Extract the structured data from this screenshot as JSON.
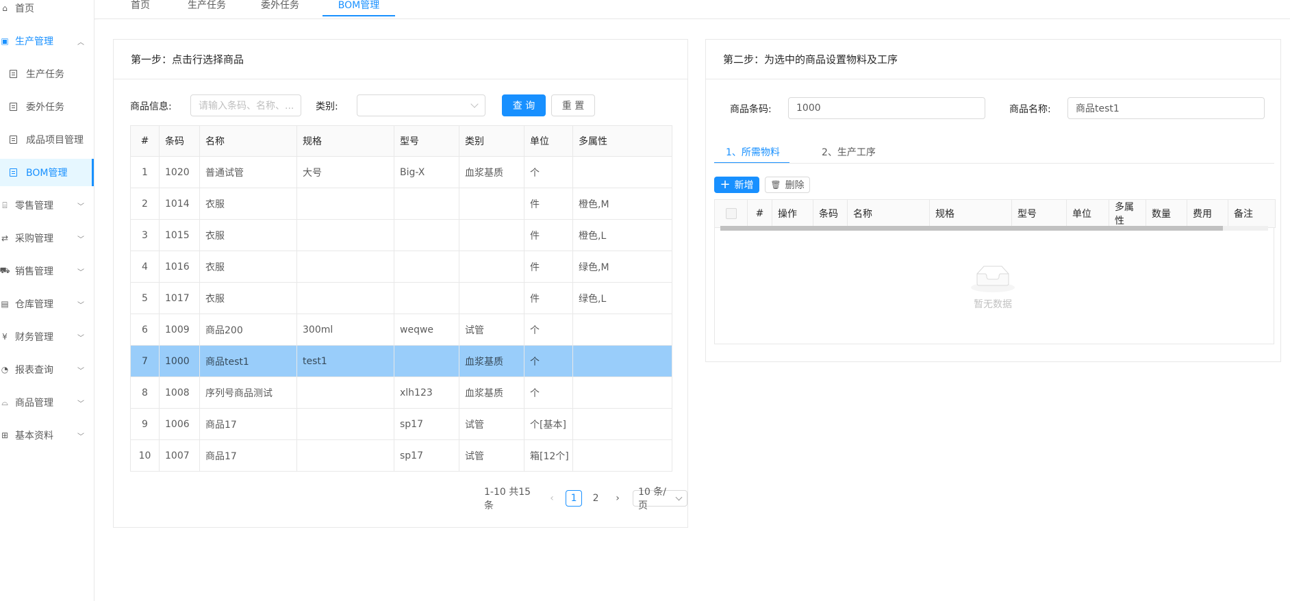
{
  "sidebar": {
    "items": [
      {
        "label": "首页",
        "icon": "home-icon"
      },
      {
        "label": "生产管理",
        "icon": "production-icon"
      },
      {
        "label": "生产任务",
        "icon": "document-icon"
      },
      {
        "label": "委外任务",
        "icon": "document-icon"
      },
      {
        "label": "成品项目管理",
        "icon": "document-icon"
      },
      {
        "label": "BOM管理",
        "icon": "document-icon"
      },
      {
        "label": "零售管理",
        "icon": "retail-icon"
      },
      {
        "label": "采购管理",
        "icon": "purchase-icon"
      },
      {
        "label": "销售管理",
        "icon": "cart-icon"
      },
      {
        "label": "仓库管理",
        "icon": "warehouse-icon"
      },
      {
        "label": "财务管理",
        "icon": "finance-icon"
      },
      {
        "label": "报表查询",
        "icon": "report-icon"
      },
      {
        "label": "商品管理",
        "icon": "goods-icon"
      },
      {
        "label": "基本资料",
        "icon": "basic-data-icon"
      }
    ]
  },
  "top_tabs": [
    "首页",
    "生产任务",
    "委外任务",
    "BOM管理"
  ],
  "left_card": {
    "title": "第一步：点击行选择商品",
    "goods_label": "商品信息:",
    "goods_placeholder": "请输入条码、名称、...",
    "category_label": "类别:",
    "category_value": "",
    "query_button": "查 询",
    "reset_button": "重 置",
    "columns": [
      "#",
      "条码",
      "名称",
      "规格",
      "型号",
      "类别",
      "单位",
      "多属性"
    ],
    "rows": [
      [
        "1",
        "1020",
        "普通试管",
        "大号",
        "Big-X",
        "血浆基质",
        "个",
        ""
      ],
      [
        "2",
        "1014",
        "衣服",
        "",
        "",
        "",
        "件",
        "橙色,M"
      ],
      [
        "3",
        "1015",
        "衣服",
        "",
        "",
        "",
        "件",
        "橙色,L"
      ],
      [
        "4",
        "1016",
        "衣服",
        "",
        "",
        "",
        "件",
        "绿色,M"
      ],
      [
        "5",
        "1017",
        "衣服",
        "",
        "",
        "",
        "件",
        "绿色,L"
      ],
      [
        "6",
        "1009",
        "商品200",
        "300ml",
        "weqwe",
        "试管",
        "个",
        ""
      ],
      [
        "7",
        "1000",
        "商品test1",
        "test1",
        "",
        "血浆基质",
        "个",
        ""
      ],
      [
        "8",
        "1008",
        "序列号商品测试",
        "",
        "xlh123",
        "血浆基质",
        "个",
        ""
      ],
      [
        "9",
        "1006",
        "商品17",
        "",
        "sp17",
        "试管",
        "个[基本]",
        ""
      ],
      [
        "10",
        "1007",
        "商品17",
        "",
        "sp17",
        "试管",
        "箱[12个]",
        ""
      ]
    ],
    "selected_row": 6,
    "pagination": {
      "total_text": "1-10 共15条",
      "pages": [
        "1",
        "2"
      ],
      "current": "1",
      "page_size": "10 条/页"
    }
  },
  "right_card": {
    "title": "第二步：为选中的商品设置物料及工序",
    "barcode_label": "商品条码:",
    "barcode_value": "1000",
    "name_label": "商品名称:",
    "name_value": "商品test1",
    "tabs": [
      "1、所需物料",
      "2、生产工序"
    ],
    "add_button": "新增",
    "delete_button": "删除",
    "columns": [
      "#",
      "操作",
      "条码",
      "名称",
      "规格",
      "型号",
      "单位",
      "多属性",
      "数量",
      "费用",
      "备注"
    ],
    "empty_text": "暂无数据"
  },
  "colors": {
    "accent": "#1890ff",
    "selected_row": "#99cdfa"
  }
}
